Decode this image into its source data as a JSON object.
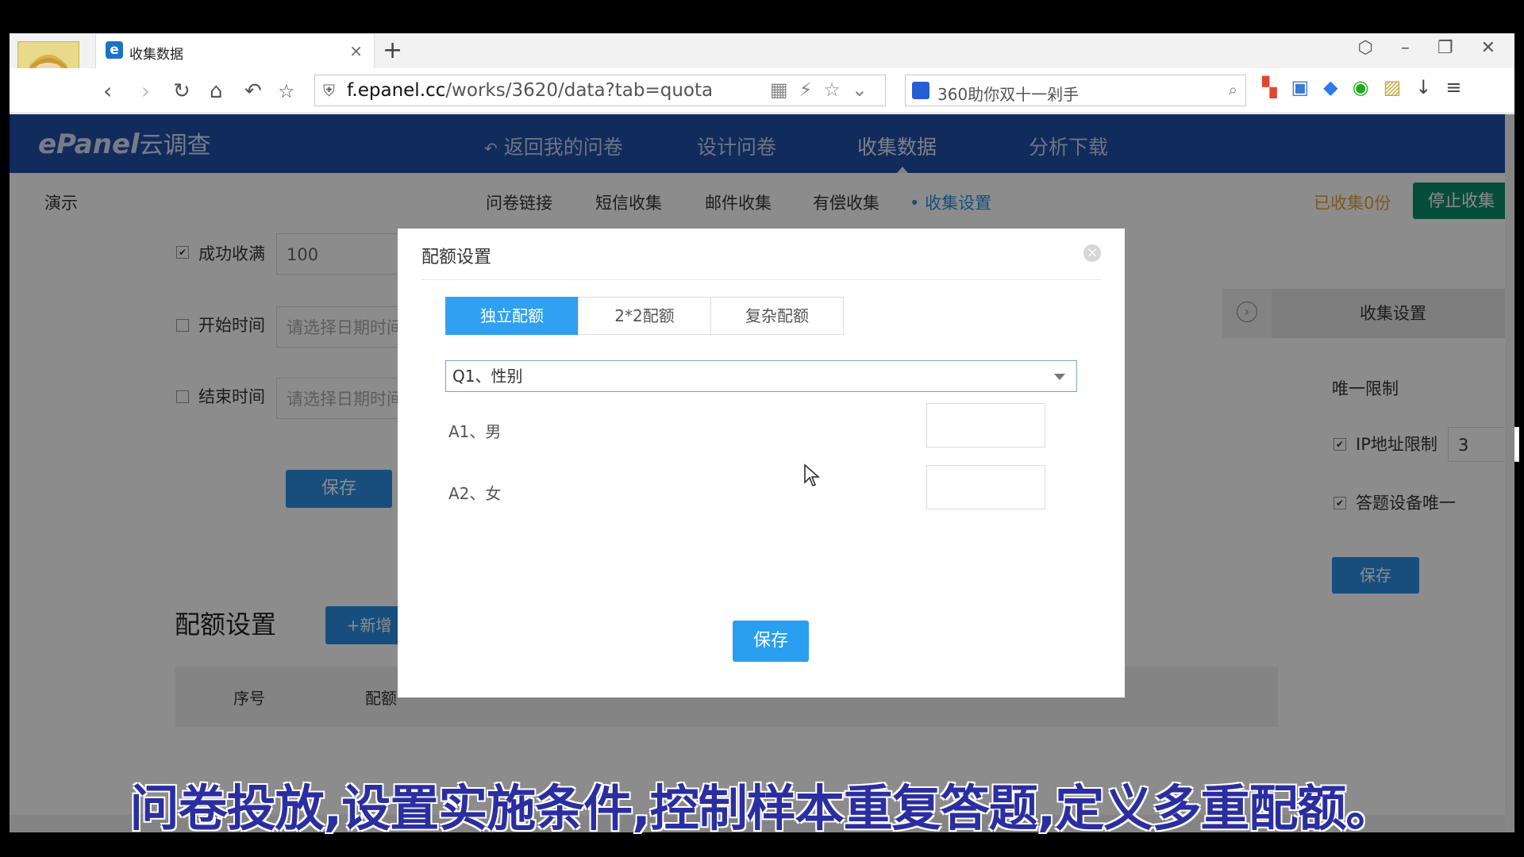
{
  "browser": {
    "tab_title": "收集数据",
    "tab_icon": "e",
    "new_tab": "+",
    "close_tab": "×",
    "window_controls": "⬡ – ❐ ✕",
    "url_host": "f.epanel.cc",
    "url_path": "/works/3620/data?tab=quota",
    "search_text": "360助你双十一剁手",
    "search_icon": "🐾"
  },
  "site": {
    "logo_main": "ePanel",
    "logo_sub": "云调查",
    "nav": [
      {
        "label": "返回我的问卷",
        "icon": "back-arrow-icon"
      },
      {
        "label": "设计问卷"
      },
      {
        "label": "收集数据"
      },
      {
        "label": "分析下载"
      }
    ],
    "nav_back_glyph": "↶",
    "project_name": "演示",
    "subnav": [
      "问卷链接",
      "短信收集",
      "邮件收集",
      "有偿收集",
      "收集设置"
    ],
    "subnav_active_dot": "•",
    "collected": "已收集0份",
    "stop_button": "停止收集"
  },
  "settings": {
    "success_label": "成功收满",
    "success_value": "100",
    "start_label": "开始时间",
    "start_placeholder": "请选择日期时间",
    "end_label": "结束时间",
    "end_placeholder": "请选择日期时间",
    "save_label": "保存",
    "quota_title": "配额设置",
    "add_quota": "+新增",
    "table_headers": [
      "序号",
      "配额"
    ]
  },
  "right_panel": {
    "title": "收集设置",
    "unique_limit": "唯一限制",
    "ip_limit_label": "IP地址限制",
    "ip_limit_value": "3",
    "device_unique_label": "答题设备唯一",
    "save_label": "保存"
  },
  "modal": {
    "title": "配额设置",
    "tabs": [
      "独立配额",
      "2*2配额",
      "复杂配额"
    ],
    "active_tab": 0,
    "question_select": "Q1、性别",
    "options": [
      {
        "label": "A1、男",
        "value": ""
      },
      {
        "label": "A2、女",
        "value": ""
      }
    ],
    "save_label": "保存"
  },
  "caption": "问卷投放,设置实施条件,控制样本重复答题,定义多重配额。",
  "colors": {
    "header_blue": "#1f4fa8",
    "accent_blue": "#2fa1f0",
    "stop_green": "#0e8f6a",
    "collected_orange": "#e6a03b",
    "caption_text": "#2b2ea0"
  }
}
